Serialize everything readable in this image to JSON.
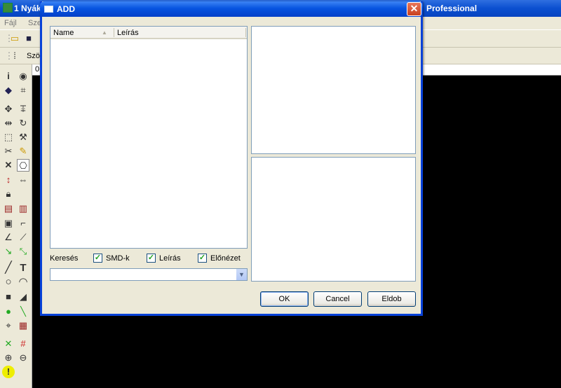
{
  "background_window": {
    "title_left": "1 Nyák",
    "title_right": "Professional",
    "menu": [
      "Fájl",
      "Sze"
    ],
    "toolbar2_label": "Szö",
    "ruler_value": "0"
  },
  "dialog": {
    "title": "ADD",
    "close_symbol": "✕",
    "list": {
      "columns": [
        "Name",
        "Leírás"
      ],
      "rows": []
    },
    "search_label": "Keresés",
    "checkboxes": [
      {
        "label": "SMD-k",
        "checked": true
      },
      {
        "label": "Leírás",
        "checked": true
      },
      {
        "label": "Előnézet",
        "checked": true
      }
    ],
    "combo_value": "",
    "buttons": {
      "ok": "OK",
      "cancel": "Cancel",
      "eldob": "Eldob"
    }
  },
  "colors": {
    "titlebar": "#0754e0",
    "dialog_bg": "#ece9d8",
    "canvas": "#000000",
    "checkmark": "#21a121"
  },
  "left_toolbar_icons": [
    "info-icon",
    "eye-icon",
    "layers-icon",
    "grid-icon",
    "move-icon",
    "group-icon",
    "mirror-icon",
    "rotate-icon",
    "select-icon",
    "wrench-icon",
    "cut-icon",
    "pen-icon",
    "delete-icon",
    "component-icon",
    "measure-icon",
    "flip-icon",
    "lock-icon",
    "resistor-icon",
    "resistor-value-icon",
    "ic-icon",
    "corner-icon",
    "line-angle-icon",
    "route-icon",
    "track-icon",
    "track2-icon",
    "line-icon",
    "text-icon",
    "circle-icon",
    "arc-icon",
    "rectangle-icon",
    "polygon-icon",
    "pad-icon",
    "wire-icon",
    "target-icon",
    "label-icon",
    "connect-icon",
    "hash-icon",
    "zoom-icon",
    "zoom-select-icon",
    "warning-icon"
  ]
}
